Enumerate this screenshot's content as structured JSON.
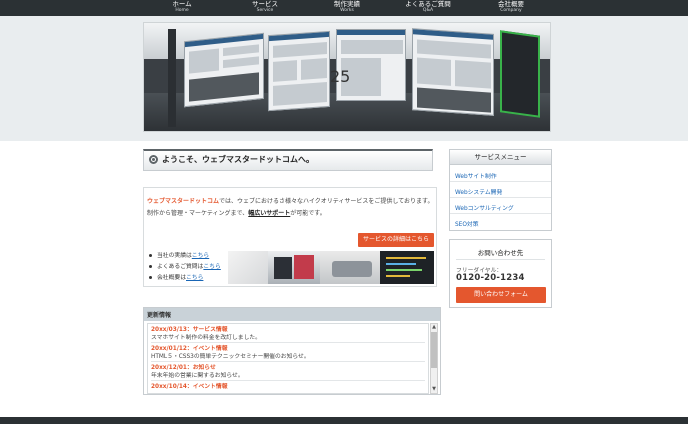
{
  "nav": {
    "items": [
      {
        "jp": "ホーム",
        "en": "Home"
      },
      {
        "jp": "サービス",
        "en": "Service"
      },
      {
        "jp": "制作実績",
        "en": "Works"
      },
      {
        "jp": "よくあるご質問",
        "en": "Q&A"
      },
      {
        "jp": "会社概要",
        "en": "Company"
      }
    ]
  },
  "hero": {
    "overlay_number": "25"
  },
  "welcome": {
    "title": "ようこそ、ウェブマスタードットコムへ。"
  },
  "intro": {
    "brand": "ウェブマスタードットコム",
    "line1_rest": "では、ウェブにおけるさ様々なハイクオリティサービスをご提供しております。",
    "line2": "制作から管理・マーケティングまで、",
    "line2_strong": "幅広いサポート",
    "line2_rest": "が可能です。",
    "service_button": "サービスの詳細はこちら",
    "list": [
      {
        "text": "当社の実績は",
        "link": "こちら"
      },
      {
        "text": "よくあるご質問は",
        "link": "こちら"
      },
      {
        "text": "会社概要は",
        "link": "こちら"
      }
    ]
  },
  "news": {
    "title": "更新情報",
    "items": [
      {
        "date": "20xx/03/13：サービス情報",
        "text": "スマホサイト制作の料金を改訂しました。"
      },
      {
        "date": "20xx/01/12：イベント情報",
        "text": "HTML５・CSS3の簡単テクニックセミナー開催のお知らせ。"
      },
      {
        "date": "20xx/12/01：お知らせ",
        "text": "年末年始の営業に関するお知らせ。"
      },
      {
        "date": "20xx/10/14：イベント情報",
        "text": ""
      }
    ]
  },
  "sidebar": {
    "service_title": "サービスメニュー",
    "service_items": [
      "Webサイト制作",
      "Webシステム開発",
      "Webコンサルティング",
      "SEO対策"
    ],
    "contact_title": "お問い合わせ先",
    "contact_label": "フリーダイヤル：",
    "contact_phone": "0120-20-1234",
    "contact_button": "問い合わせフォーム"
  },
  "colors": {
    "accent": "#e4572e",
    "link": "#1a66b5",
    "nav_bg": "#2b3134"
  }
}
